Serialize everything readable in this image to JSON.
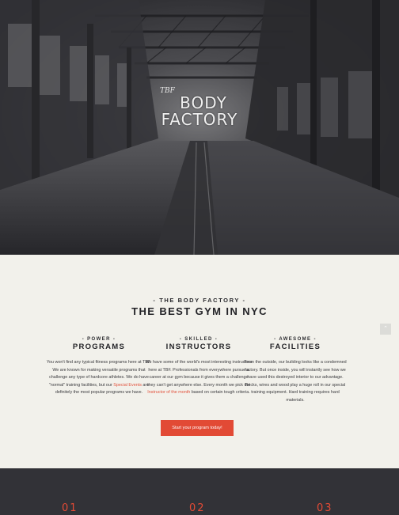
{
  "hero": {
    "logo_mark": "TBF",
    "logo_line1": "BODY",
    "logo_line2": "FACTORY"
  },
  "intro": {
    "eyebrow": "- THE BODY FACTORY -",
    "headline": "THE BEST GYM IN NYC"
  },
  "features": [
    {
      "kicker": "- POWER -",
      "title": "PROGRAMS",
      "body_before": "You won't find any typical fitness programs here at TBF. We are known for making versatile programs that challenge any type of hardcore athletes. We do have \"normal\" training facilities, but our ",
      "link": "Special Events",
      "body_after": " are definitely the most popular programs we have."
    },
    {
      "kicker": "- SKILLED -",
      "title": "INSTRUCTORS",
      "body_before": "We have some of the world's most interesting instructors here at TBF. Professionals from everywhere pursue a career at our gym because it gives them a challenge they can't get anywhere else. Every month we pick the ",
      "link": "Instructor of the month",
      "body_after": " based on certain tough criteria."
    },
    {
      "kicker": "- AWESOME -",
      "title": "FACILITIES",
      "body_before": "From the outside, our building looks like a condemned factory. But once inside, you will instantly see how we have used this destroyed interior to our advantage. Bricks, wires and wood play a huge roll in our special training equipment. Hard training requires hard materials.",
      "link": "",
      "body_after": ""
    }
  ],
  "cta": {
    "label": "Start your program today!"
  },
  "scroll_top": {
    "icon": "chevron-up-icon"
  },
  "numbers": [
    "01",
    "02",
    "03"
  ],
  "colors": {
    "accent": "#e24a35",
    "dark": "#323237",
    "light": "#f2f1eb"
  }
}
